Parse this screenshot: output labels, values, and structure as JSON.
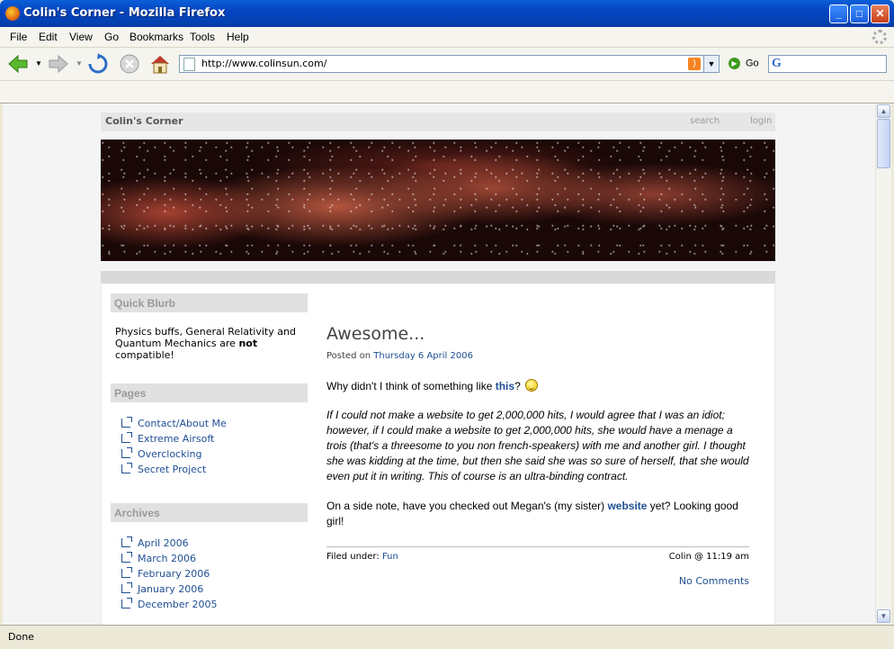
{
  "window": {
    "title": "Colin's Corner - Mozilla Firefox"
  },
  "menu": {
    "items": [
      "File",
      "Edit",
      "View",
      "Go",
      "Bookmarks",
      "Tools",
      "Help"
    ]
  },
  "toolbar": {
    "url": "http://www.colinsun.com/",
    "go_label": "Go"
  },
  "status": {
    "text": "Done"
  },
  "site": {
    "name": "Colin's Corner",
    "header_links": [
      "search",
      "login"
    ]
  },
  "sidebar": {
    "blurb": {
      "title": "Quick Blurb",
      "text_before": "Physics buffs, General Relativity and Quantum Mechanics are ",
      "text_bold": "not",
      "text_after": " compatible!"
    },
    "pages": {
      "title": "Pages",
      "items": [
        "Contact/About Me",
        "Extreme Airsoft",
        "Overclocking",
        "Secret Project"
      ]
    },
    "archives": {
      "title": "Archives",
      "items": [
        "April 2006",
        "March 2006",
        "February 2006",
        "January 2006",
        "December 2005"
      ]
    }
  },
  "post": {
    "title": "Awesome...",
    "posted_on_label": "Posted on",
    "date": "Thursday 6 April 2006",
    "p1_before": "Why didn't I think of something like ",
    "p1_link": "this",
    "p1_after": "?",
    "quote": "If I could not make a website to get 2,000,000 hits, I would agree that I was an idiot; however, if I could make a website to get 2,000,000 hits, she would have a menage a trois (that's a threesome to you non french-speakers) with me and another girl. I thought she was kidding at the time, but then she said she was so sure of herself, that she would even put it in writing.  This of course is an ultra-binding contract.",
    "p3_before": "On a side note, have you checked out Megan's (my sister) ",
    "p3_link": "website",
    "p3_after": " yet? Looking good girl!",
    "filed_label": "Filed under:",
    "category": "Fun",
    "meta": "Colin @ 11:19 am",
    "comments": "No Comments"
  }
}
